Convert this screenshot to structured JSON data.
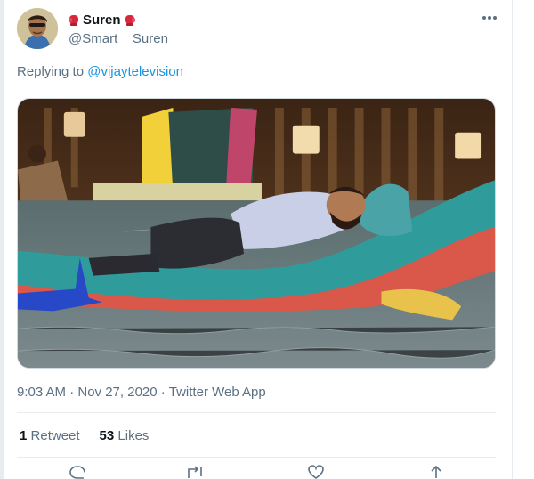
{
  "tweet": {
    "author": {
      "display_name": "Suren",
      "handle": "@Smart__Suren",
      "name_emoji": "boxing-glove-icon"
    },
    "replying_to_prefix": "Replying to",
    "replying_to_handle": "@vijaytelevision",
    "media": {
      "description_icon": "photo"
    },
    "timestamp": "9:03 AM · Nov 27, 2020 ·",
    "source": "Twitter Web App",
    "stats": {
      "retweets_count": "1",
      "retweets_label": "Retweet",
      "likes_count": "53",
      "likes_label": "Likes"
    },
    "actions": [
      "reply-icon",
      "retweet-icon",
      "like-icon",
      "share-icon"
    ]
  },
  "colors": {
    "link": "#1b95e0",
    "secondary_text": "#5b7083",
    "glove_red": "#d6293d"
  }
}
